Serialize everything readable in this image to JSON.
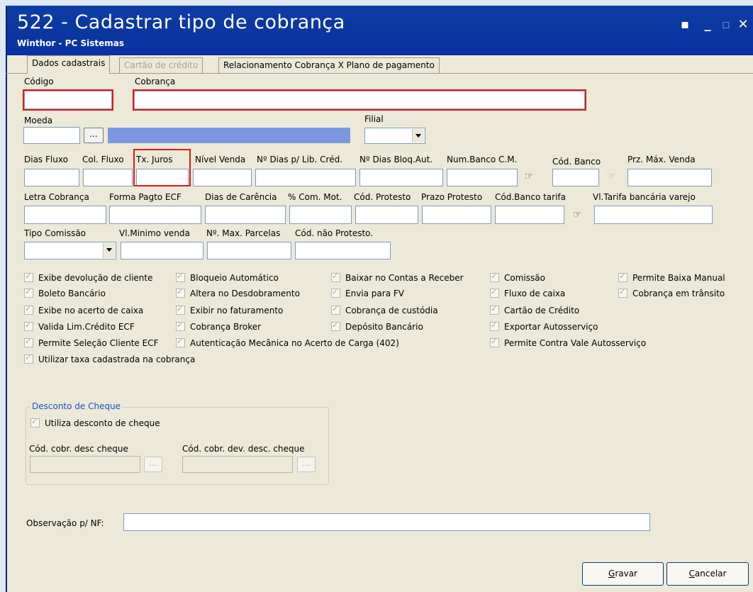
{
  "window": {
    "title": "522 - Cadastrar tipo de cobrança",
    "subtitle": "Winthor - PC Sistemas",
    "controls": {
      "restore": "▪",
      "minimize": "_",
      "maximize": "▫",
      "close": "✕"
    }
  },
  "tabs": [
    {
      "label": "Dados cadastrais",
      "state": "active"
    },
    {
      "label": "Cartão de crédito",
      "state": "disabled"
    },
    {
      "label": "Relacionamento Cobrança X Plano de pagamento",
      "state": "normal"
    }
  ],
  "fields": {
    "codigo": {
      "label": "Código",
      "value": ""
    },
    "cobranca": {
      "label": "Cobrança",
      "value": ""
    },
    "moeda": {
      "label": "Moeda",
      "value": "",
      "button": "..."
    },
    "filial": {
      "label": "Filial",
      "value": ""
    },
    "dias_fluxo": {
      "label": "Dias Fluxo",
      "value": ""
    },
    "col_fluxo": {
      "label": "Col. Fluxo",
      "value": ""
    },
    "tx_juros": {
      "label": "Tx. Juros",
      "value": ""
    },
    "nivel_venda": {
      "label": "Nível Venda",
      "value": ""
    },
    "dias_lib_cred": {
      "label": "Nº Dias p/ Lib. Créd.",
      "value": ""
    },
    "dias_bloq_aut": {
      "label": "Nº Dias Bloq.Aut.",
      "value": ""
    },
    "num_banco_cm": {
      "label": "Num.Banco C.M.",
      "value": ""
    },
    "cod_banco": {
      "label": "Cód. Banco",
      "value": ""
    },
    "prz_max_venda": {
      "label": "Prz. Máx. Venda",
      "value": ""
    },
    "letra_cobranca": {
      "label": "Letra Cobrança",
      "value": ""
    },
    "forma_pagto_ecf": {
      "label": "Forma Pagto ECF",
      "value": ""
    },
    "dias_carencia": {
      "label": "Dias de Carência",
      "value": ""
    },
    "com_mot": {
      "label": "% Com. Mot.",
      "value": ""
    },
    "cod_protesto": {
      "label": "Cód. Protesto",
      "value": ""
    },
    "prazo_protesto": {
      "label": "Prazo Protesto",
      "value": ""
    },
    "cod_banco_tarifa": {
      "label": "Cód.Banco tarifa",
      "value": ""
    },
    "vl_tarifa": {
      "label": "Vl.Tarifa bancária varejo",
      "value": ""
    },
    "tipo_comissao": {
      "label": "Tipo Comissão",
      "value": ""
    },
    "vl_minimo_venda": {
      "label": "Vl.Minimo venda",
      "value": ""
    },
    "max_parcelas": {
      "label": "Nº. Max. Parcelas",
      "value": ""
    },
    "cod_nao_protesto": {
      "label": "Cód. não  Protesto.",
      "value": ""
    },
    "observacao_nf": {
      "label": "Observação p/ NF:",
      "value": ""
    }
  },
  "checkboxes": [
    {
      "label": "Exibe devolução de cliente",
      "checked": true
    },
    {
      "label": "Bloqueio Automático",
      "checked": true
    },
    {
      "label": "Baixar no Contas a Receber",
      "checked": true
    },
    {
      "label": "Comissão",
      "checked": true
    },
    {
      "label": "Permite Baixa Manual",
      "checked": true
    },
    {
      "label": "Boleto Bancário",
      "checked": true
    },
    {
      "label": "Altera no Desdobramento",
      "checked": true
    },
    {
      "label": "Envia para FV",
      "checked": true
    },
    {
      "label": "Fluxo de caixa",
      "checked": true
    },
    {
      "label": "Cobrança em trânsito",
      "checked": true
    },
    {
      "label": "Exibe no acerto de caixa",
      "checked": true
    },
    {
      "label": "Exibir no faturamento",
      "checked": true
    },
    {
      "label": "Cobrança de custódia",
      "checked": true
    },
    {
      "label": "Cartão de Crédito",
      "checked": true
    },
    {
      "label": "Valida Lim.Crédito ECF",
      "checked": true
    },
    {
      "label": "Cobrança Broker",
      "checked": true
    },
    {
      "label": "Depósito Bancário",
      "checked": true
    },
    {
      "label": "Exportar Autosserviço",
      "checked": true
    },
    {
      "label": "Permite Seleção Cliente ECF",
      "checked": true
    },
    {
      "label": "Autenticação Mecânica no Acerto de Carga (402)",
      "checked": true
    },
    {
      "label": "Permite Contra Vale Autosserviço",
      "checked": true
    },
    {
      "label": "Utilizar taxa cadastrada na cobrança",
      "checked": true
    }
  ],
  "desconto_cheque": {
    "title": "Desconto de Cheque",
    "utiliza": {
      "label": "Utiliza desconto de cheque",
      "checked": true
    },
    "cod_cobr_desc": {
      "label": "Cód. cobr. desc cheque",
      "value": "",
      "button": "..."
    },
    "cod_cobr_dev": {
      "label": "Cód. cobr. dev. desc. cheque",
      "value": "",
      "button": "..."
    }
  },
  "buttons": {
    "gravar": {
      "first": "G",
      "rest": "ravar"
    },
    "cancelar": {
      "first": "C",
      "rest": "ancelar"
    }
  },
  "icons": {
    "lookup": "hand-pointer-icon"
  },
  "colors": {
    "title_bar": "#0b38a0",
    "highlight": "#e8151b",
    "moeda_desc": "#7b97df",
    "group_title": "#1c50c8"
  }
}
